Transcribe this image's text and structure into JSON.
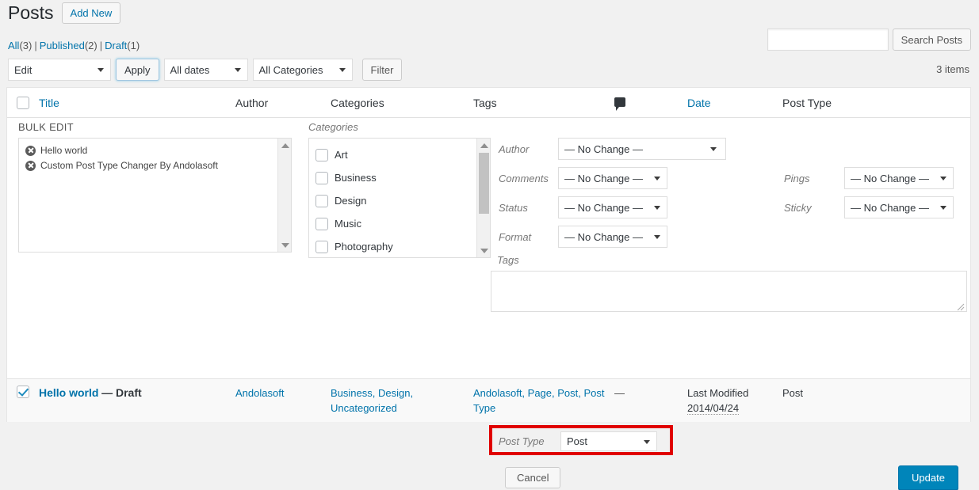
{
  "header": {
    "title": "Posts",
    "add_new_label": "Add New"
  },
  "views": [
    {
      "label": "All",
      "count": "(3)"
    },
    {
      "label": "Published",
      "count": "(2)"
    },
    {
      "label": "Draft",
      "count": "(1)"
    }
  ],
  "search": {
    "value": "",
    "placeholder": "",
    "button_label": "Search Posts"
  },
  "tablenav": {
    "bulk_action": "Edit",
    "apply_label": "Apply",
    "date_filter": "All dates",
    "category_filter": "All Categories",
    "filter_label": "Filter",
    "item_count": "3 items"
  },
  "table": {
    "columns": {
      "title": "Title",
      "author": "Author",
      "categories": "Categories",
      "tags": "Tags",
      "comments_icon": "comment-bubble-icon",
      "date": "Date",
      "post_type": "Post Type"
    }
  },
  "bulk_edit": {
    "label": "BULK EDIT",
    "titles": [
      "Hello world",
      "Custom Post Type Changer By Andolasoft"
    ],
    "categories_label": "Categories",
    "categories": [
      "Art",
      "Business",
      "Design",
      "Music",
      "Photography"
    ],
    "fields": {
      "author_label": "Author",
      "author_value": "— No Change —",
      "comments_label": "Comments",
      "comments_value": "— No Change —",
      "status_label": "Status",
      "status_value": "— No Change —",
      "format_label": "Format",
      "format_value": "— No Change —",
      "pings_label": "Pings",
      "pings_value": "— No Change —",
      "sticky_label": "Sticky",
      "sticky_value": "— No Change —",
      "tags_label": "Tags",
      "tags_value": "",
      "post_type_label": "Post Type",
      "post_type_value": "Post"
    },
    "cancel_label": "Cancel",
    "update_label": "Update"
  },
  "post_row": {
    "title": "Hello world",
    "state": "— Draft",
    "author": "Andolasoft",
    "categories": "Business, Design, Uncategorized",
    "tags": "Andolasoft, Page, Post, Post Type",
    "comments": "—",
    "date_label": "Last Modified",
    "date_value": "2014/04/24",
    "post_type": "Post"
  },
  "colors": {
    "accent_blue": "#0073aa",
    "button_blue": "#0085ba",
    "highlight_red": "#e00000"
  }
}
